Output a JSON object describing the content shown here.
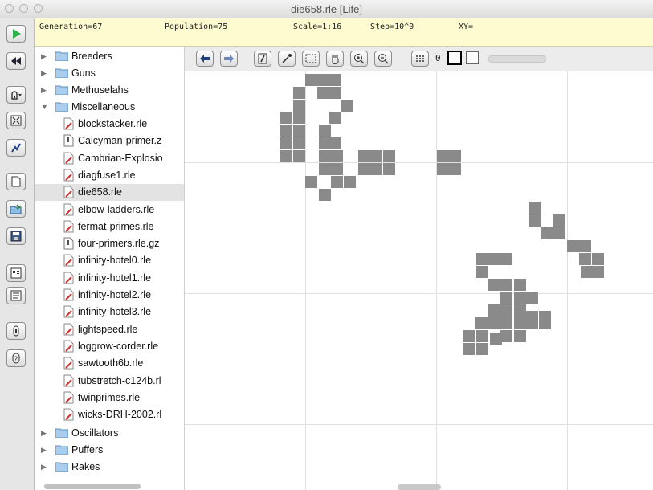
{
  "window": {
    "title": "die658.rle [Life]"
  },
  "status": {
    "generation": "Generation=67",
    "population": "Population=75",
    "scale": "Scale=1:16",
    "step": "Step=10^0",
    "xy": "XY="
  },
  "toolbar_left": {
    "icons": [
      "play-icon",
      "reset-icon",
      "algo-menu-icon",
      "fit-icon",
      "info-graph-icon",
      "new-pattern-icon",
      "open-pattern-icon",
      "save-pattern-icon",
      "scripts-panel-icon",
      "patterns-panel-icon",
      "info-icon",
      "help-icon"
    ]
  },
  "edit_toolbar": {
    "state_value": "0",
    "icons": [
      "back-arrow-icon",
      "forward-arrow-icon",
      "pencil-draw-icon",
      "eyedropper-pick-icon",
      "select-icon",
      "hand-move-icon",
      "zoom-in-icon",
      "zoom-out-icon",
      "all-states-icon"
    ]
  },
  "tree": {
    "folders_top": [
      "Breeders",
      "Guns",
      "Methuselahs"
    ],
    "open_folder": "Miscellaneous",
    "files": [
      "blockstacker.rle",
      "Calcyman-primer.z",
      "Cambrian-Explosio",
      "diagfuse1.rle",
      "die658.rle",
      "elbow-ladders.rle",
      "fermat-primes.rle",
      "four-primers.rle.gz",
      "infinity-hotel0.rle",
      "infinity-hotel1.rle",
      "infinity-hotel2.rle",
      "infinity-hotel3.rle",
      "lightspeed.rle",
      "loggrow-corder.rle",
      "sawtooth6b.rle",
      "tubstretch-c124b.rl",
      "twinprimes.rle",
      "wicks-DRH-2002.rl"
    ],
    "selected": "die658.rle",
    "folders_bottom": [
      "Oscillators",
      "Puffers",
      "Rakes"
    ]
  },
  "colors": {
    "live_cell": "#8a8a8a",
    "status_bg": "#fffbd0",
    "play_green": "#2bb24c"
  }
}
